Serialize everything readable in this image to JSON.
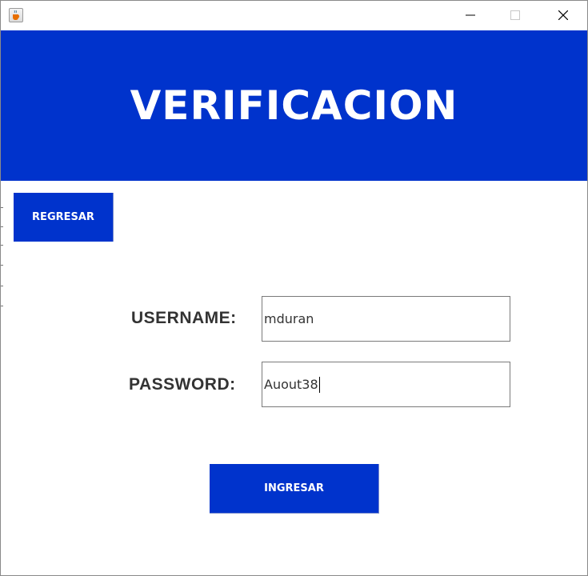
{
  "window": {
    "icon": "java-coffee-icon",
    "controls": [
      "minimize-icon",
      "maximize-icon",
      "close-icon"
    ]
  },
  "banner": {
    "title": "VERIFICACION",
    "color": "#0033cc"
  },
  "buttons": {
    "back_label": "REGRESAR",
    "submit_label": "INGRESAR"
  },
  "form": {
    "username_label": "USERNAME:",
    "username_value": "mduran",
    "password_label": "PASSWORD:",
    "password_value": "Auout38"
  },
  "colors": {
    "accent": "#0033cc",
    "label_text": "#333333"
  }
}
